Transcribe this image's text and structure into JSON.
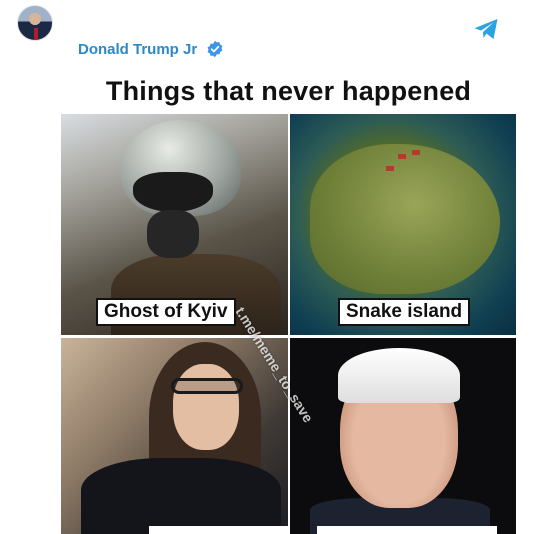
{
  "post": {
    "author": "Donald Trump Jr",
    "verified_icon": "verified-badge-icon",
    "channel_icon": "telegram-icon"
  },
  "meme": {
    "title": "Things that never happened",
    "captions": [
      "Ghost of Kyiv",
      "Snake island"
    ],
    "watermark": "t.me/meme_to_save"
  },
  "colors": {
    "author": "#2b8ac6",
    "telegram": "#2aa3e0",
    "verified": "#3b97e3"
  }
}
